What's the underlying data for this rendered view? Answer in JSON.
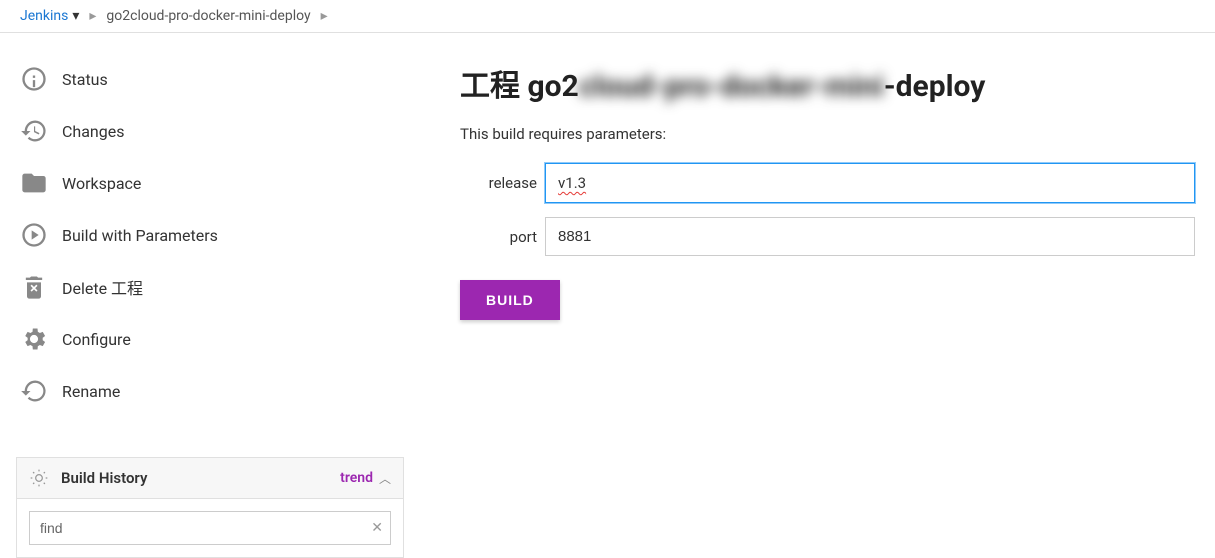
{
  "breadcrumb": {
    "root": "Jenkins",
    "job": "go2cloud-pro-docker-mini-deploy"
  },
  "sidebar": {
    "items": [
      {
        "label": "Status"
      },
      {
        "label": "Changes"
      },
      {
        "label": "Workspace"
      },
      {
        "label": "Build with Parameters"
      },
      {
        "label": "Delete 工程"
      },
      {
        "label": "Configure"
      },
      {
        "label": "Rename"
      }
    ]
  },
  "history": {
    "title": "Build History",
    "trend_label": "trend",
    "find_value": "find"
  },
  "main": {
    "title_prefix": "工程 go2",
    "title_blurred": "cloud-pro-docker-mini",
    "title_suffix": "-deploy",
    "subtitle": "This build requires parameters:",
    "params": [
      {
        "label": "release",
        "value": "v1.3",
        "focused": true,
        "squiggle": true
      },
      {
        "label": "port",
        "value": "8881",
        "focused": false,
        "squiggle": false
      }
    ],
    "build_button": "BUILD"
  }
}
